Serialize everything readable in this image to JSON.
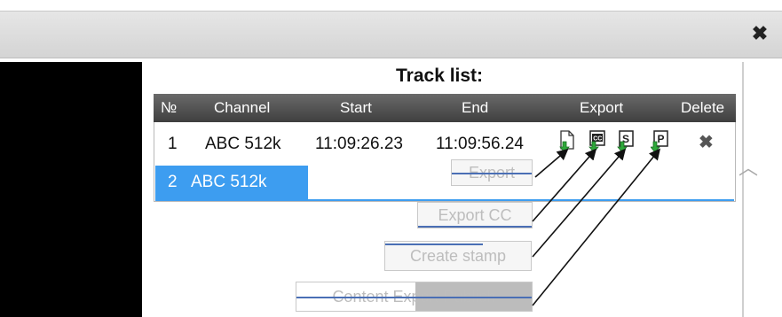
{
  "window": {
    "close_icon": "close-icon"
  },
  "track_list": {
    "title": "Track list:",
    "columns": [
      "№",
      "Channel",
      "Start",
      "End",
      "Export",
      "Delete"
    ],
    "rows": [
      {
        "num": "1",
        "channel": "ABC 512k",
        "start": "11:09:26.23",
        "end": "11:09:56.24"
      },
      {
        "num": "2",
        "channel": "ABC 512k"
      }
    ]
  },
  "buttons": {
    "export": "Export",
    "export_cc": "Export CC",
    "create_stamp": "Create stamp",
    "content_export_publish": "Content Export Publish"
  },
  "colors": {
    "selected_row": "#3d9df0",
    "header_bg": "#4f4f4f",
    "arrow_green": "#2ea83a"
  }
}
